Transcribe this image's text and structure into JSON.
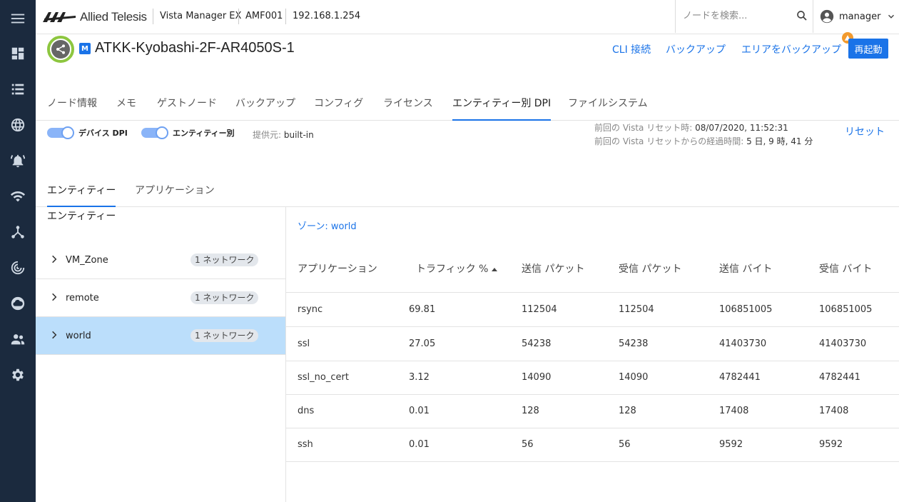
{
  "app": {
    "brand": "Allied Telesis",
    "product": "Vista Manager EX",
    "area": "AMF001",
    "ip": "192.168.1.254"
  },
  "search": {
    "placeholder": "ノードを検索..."
  },
  "user": {
    "name": "manager"
  },
  "node": {
    "title": "ATKK-Kyobashi-2F-AR4050S-1",
    "badge": "M",
    "actions": {
      "cli": "CLI 接続",
      "backup": "バックアップ",
      "area_backup": "エリアをバックアップ",
      "reboot": "再起動"
    }
  },
  "main_tabs": [
    "ノード情報",
    "メモ",
    "ゲストノード",
    "バックアップ",
    "コンフィグ",
    "ライセンス",
    "エンティティー別 DPI",
    "ファイルシステム"
  ],
  "active_main_tab": "エンティティー別 DPI",
  "dpi": {
    "device_dpi_label": "デバイス DPI",
    "device_dpi_on": true,
    "entity_label": "エンティティー別",
    "entity_on": true,
    "provider_label": "提供元:",
    "provider_value": "built-in",
    "last_reset_label": "前回の Vista リセット時:",
    "last_reset_value": "08/07/2020, 11:52:31",
    "elapsed_label": "前回の Vista リセットからの経過時間:",
    "elapsed_value": "5 日, 9 時, 41 分",
    "reset_link": "リセット"
  },
  "sub_tabs": [
    "エンティティー",
    "アプリケーション"
  ],
  "active_sub_tab": "エンティティー",
  "entities": {
    "header": "エンティティー",
    "items": [
      {
        "name": "VM_Zone",
        "chip": "1 ネットワーク"
      },
      {
        "name": "remote",
        "chip": "1 ネットワーク"
      },
      {
        "name": "world",
        "chip": "1 ネットワーク"
      }
    ],
    "selected": "world"
  },
  "zone": {
    "label": "ゾーン: world"
  },
  "table": {
    "columns": [
      "アプリケーション",
      "トラフィック %",
      "送信 パケット",
      "受信 パケット",
      "送信 バイト",
      "受信 バイト"
    ],
    "sort_column": "トラフィック %",
    "rows": [
      [
        "rsync",
        "69.81",
        "112504",
        "112504",
        "106851005",
        "106851005"
      ],
      [
        "ssl",
        "27.05",
        "54238",
        "54238",
        "41403730",
        "41403730"
      ],
      [
        "ssl_no_cert",
        "3.12",
        "14090",
        "14090",
        "4782441",
        "4782441"
      ],
      [
        "dns",
        "0.01",
        "128",
        "128",
        "17408",
        "17408"
      ],
      [
        "ssh",
        "0.01",
        "56",
        "56",
        "9592",
        "9592"
      ]
    ]
  },
  "colors": {
    "sidebar": "#1b2a3e",
    "accent": "#1a73e8",
    "selected_row": "#bbdefb",
    "node_ring": "#8dc63f"
  }
}
